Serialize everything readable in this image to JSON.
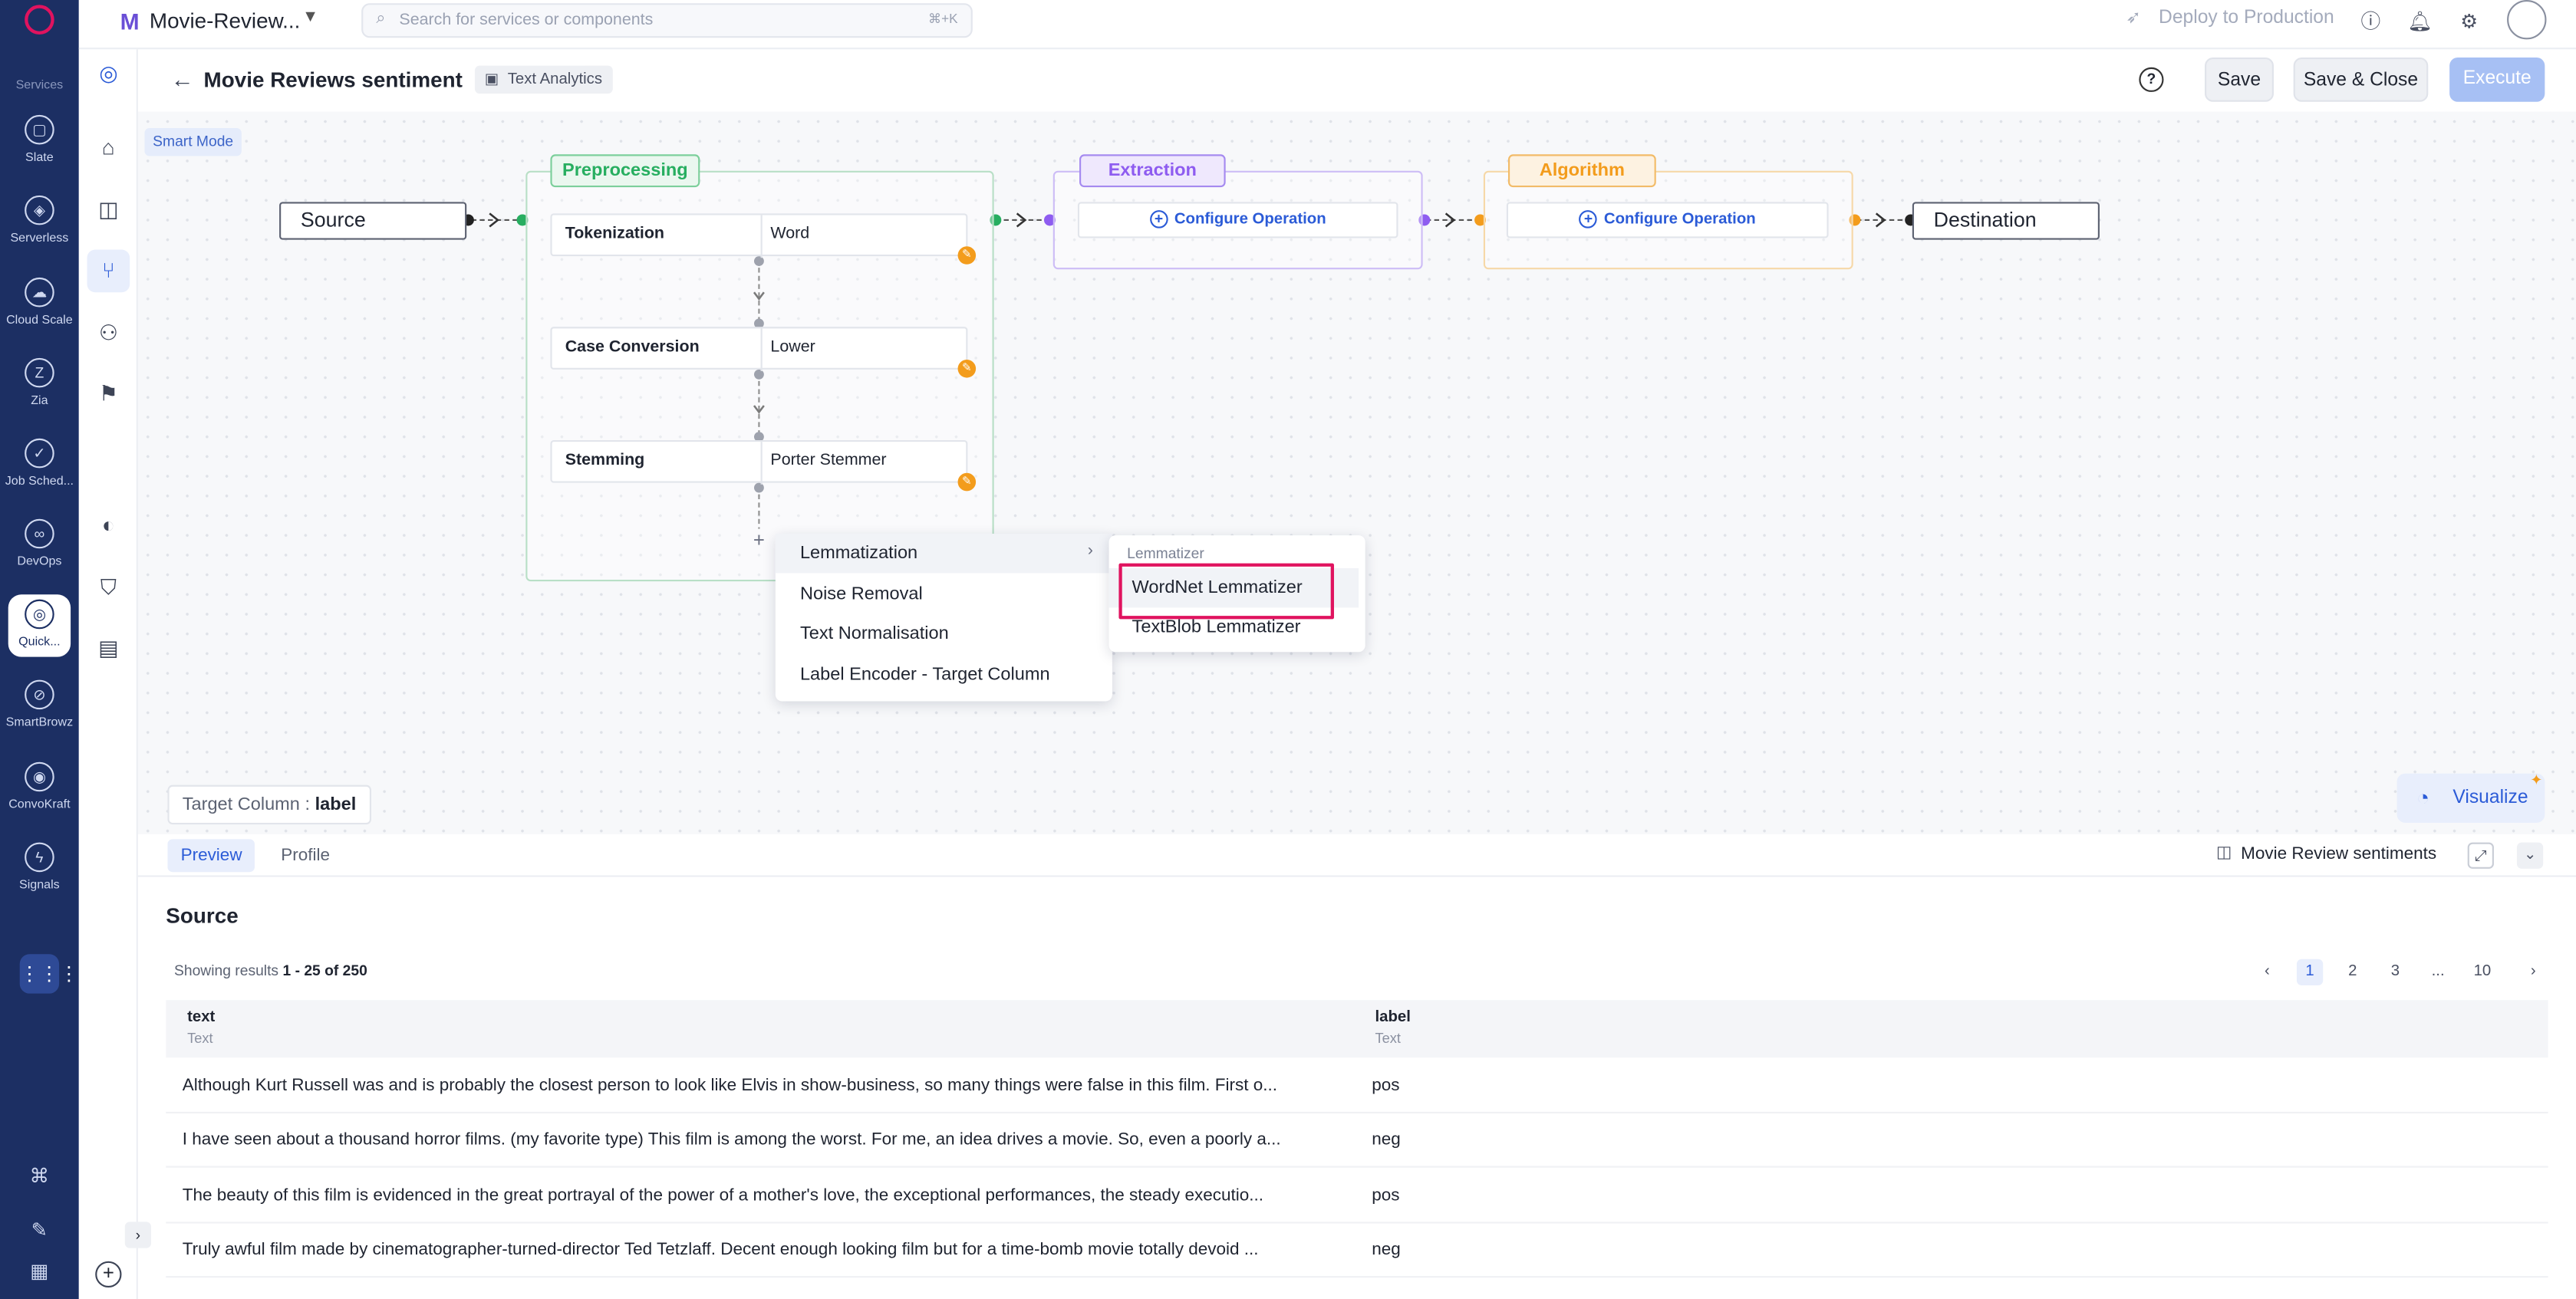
{
  "rail": {
    "section_label": "Services",
    "items": [
      {
        "label": "Slate",
        "icon": "slate-icon",
        "glyph": "▢"
      },
      {
        "label": "Serverless",
        "icon": "serverless-icon",
        "glyph": "◈"
      },
      {
        "label": "Cloud Scale",
        "icon": "cloud-scale-icon",
        "glyph": "☁"
      },
      {
        "label": "Zia",
        "icon": "zia-icon",
        "glyph": "Z"
      },
      {
        "label": "Job Sched...",
        "icon": "job-scheduler-icon",
        "glyph": "✓"
      },
      {
        "label": "DevOps",
        "icon": "devops-icon",
        "glyph": "∞"
      },
      {
        "label": "Quick...",
        "icon": "quickml-icon",
        "glyph": "◎"
      },
      {
        "label": "SmartBrowz",
        "icon": "smartbrowz-icon",
        "glyph": "⊘"
      },
      {
        "label": "ConvoKraft",
        "icon": "convokraft-icon",
        "glyph": "◉"
      },
      {
        "label": "Signals",
        "icon": "signals-icon",
        "glyph": "ϟ"
      }
    ],
    "apps_glyph": "⋮⋮⋮"
  },
  "topbar": {
    "project_initial": "M",
    "project_name": "Movie-Review...",
    "search_placeholder": "Search for services or components",
    "search_shortcut": "⌘+K",
    "deploy_label": "Deploy to Production"
  },
  "header": {
    "title": "Movie Reviews sentiment",
    "tag": "Text Analytics",
    "save": "Save",
    "save_close": "Save & Close",
    "execute": "Execute"
  },
  "canvas": {
    "smart_mode": "Smart Mode",
    "source": "Source",
    "destination": "Destination",
    "preprocessing_label": "Preprocessing",
    "extraction_label": "Extraction",
    "algorithm_label": "Algorithm",
    "configure_label": "Configure Operation",
    "operations": [
      {
        "name": "Tokenization",
        "value": "Word"
      },
      {
        "name": "Case Conversion",
        "value": "Lower"
      },
      {
        "name": "Stemming",
        "value": "Porter Stemmer"
      }
    ],
    "add_glyph": "+",
    "colors": {
      "preprocessing": "#27ae60",
      "extraction": "#8e5cf0",
      "algorithm": "#f39c1c"
    }
  },
  "menu": {
    "items": [
      "Lemmatization",
      "Noise Removal",
      "Text Normalisation",
      "Label Encoder - Target Column"
    ],
    "submenu_header": "Lemmatizer",
    "submenu_items": [
      "WordNet Lemmatizer",
      "TextBlob Lemmatizer"
    ]
  },
  "target_column": {
    "label": "Target Column :",
    "value": "label"
  },
  "visualize": "Visualize",
  "panel": {
    "tabs": [
      "Preview",
      "Profile"
    ],
    "dataset": "Movie Review sentiments",
    "section_title": "Source",
    "results_prefix": "Showing results",
    "results_range": "1 - 25 of 250",
    "pages": [
      "1",
      "2",
      "3",
      "...",
      "10"
    ],
    "columns": [
      {
        "name": "text",
        "type": "Text"
      },
      {
        "name": "label",
        "type": "Text"
      }
    ],
    "rows": [
      {
        "text": "Although Kurt Russell was and is probably the closest person to look like Elvis in show-business, so many things were false in this film. First o...",
        "label": "pos"
      },
      {
        "text": "I have seen about a thousand horror films. (my favorite type) This film is among the worst. For me, an idea drives a movie. So, even a poorly a...",
        "label": "neg"
      },
      {
        "text": "The beauty of this film is evidenced in the great portrayal of the power of a mother's love, the exceptional performances, the steady executio...",
        "label": "pos"
      },
      {
        "text": "Truly awful film made by cinematographer-turned-director Ted Tetzlaff. Decent enough looking film but for a time-bomb movie totally devoid ...",
        "label": "neg"
      }
    ]
  }
}
